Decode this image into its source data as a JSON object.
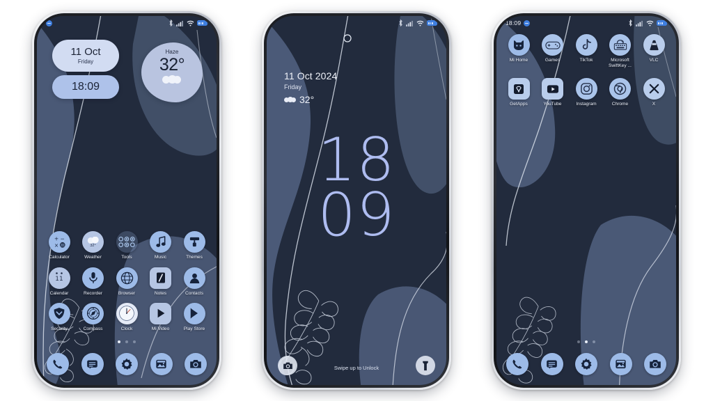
{
  "screens": {
    "home1": {
      "name": "home-screen-page-1",
      "statusbar": {
        "left_badge": "notification-dot",
        "icons": [
          "bluetooth-icon",
          "signal-icon",
          "wifi-icon",
          "battery-icon"
        ]
      },
      "widgets": {
        "date_widget": {
          "date": "11 Oct",
          "weekday": "Friday"
        },
        "time_widget": {
          "time": "18:09"
        },
        "weather_widget": {
          "condition": "Haze",
          "temperature": "32°",
          "icon": "cloud-icon"
        }
      },
      "rows": [
        [
          {
            "label": "Calculator",
            "icon": "calculator-icon"
          },
          {
            "label": "Weather",
            "icon": "weather-icon",
            "badge": "32°"
          },
          {
            "label": "Tools",
            "icon": "tools-folder-icon"
          },
          {
            "label": "Music",
            "icon": "music-note-icon"
          },
          {
            "label": "Themes",
            "icon": "themes-roller-icon"
          }
        ],
        [
          {
            "label": "Calendar",
            "icon": "calendar-icon",
            "badge": "11"
          },
          {
            "label": "Recorder",
            "icon": "microphone-icon"
          },
          {
            "label": "Browser",
            "icon": "globe-icon"
          },
          {
            "label": "Notes",
            "icon": "notes-pencil-icon"
          },
          {
            "label": "Contacts",
            "icon": "person-icon"
          }
        ],
        [
          {
            "label": "Security",
            "icon": "shield-icon"
          },
          {
            "label": "Compass",
            "icon": "compass-icon"
          },
          {
            "label": "Clock",
            "icon": "analog-clock-icon"
          },
          {
            "label": "Mi Video",
            "icon": "play-triangle-icon"
          },
          {
            "label": "Play Store",
            "icon": "play-store-icon"
          }
        ]
      ],
      "page_dots": {
        "count": 3,
        "active": 0
      },
      "dock": [
        {
          "label": "Phone",
          "icon": "phone-handset-icon"
        },
        {
          "label": "Messages",
          "icon": "message-bubble-icon"
        },
        {
          "label": "Settings",
          "icon": "gear-icon"
        },
        {
          "label": "Gallery",
          "icon": "gallery-image-icon"
        },
        {
          "label": "Camera",
          "icon": "camera-icon"
        }
      ]
    },
    "lock": {
      "name": "lock-screen",
      "statusbar": {
        "icons": [
          "bluetooth-icon",
          "signal-icon",
          "wifi-icon",
          "battery-icon"
        ]
      },
      "date": "11 Oct 2024",
      "weekday": "Friday",
      "temperature": "32°",
      "weather_icon": "cloud-icon",
      "clock_hours": "18",
      "clock_minutes": "09",
      "hint": "Swipe up to Unlock",
      "shortcut_left": "camera-icon",
      "shortcut_right": "flashlight-icon"
    },
    "home2": {
      "name": "home-screen-page-2",
      "statusbar": {
        "clock": "18:09",
        "left_badge": "notification-dot",
        "icons": [
          "bluetooth-icon",
          "signal-icon",
          "wifi-icon",
          "battery-icon"
        ]
      },
      "rows": [
        [
          {
            "label": "Mi Home",
            "icon": "mi-home-icon"
          },
          {
            "label": "Games",
            "icon": "gamepad-icon"
          },
          {
            "label": "TikTok",
            "icon": "tiktok-icon"
          },
          {
            "label": "Microsoft SwiftKey ...",
            "icon": "swiftkey-icon"
          },
          {
            "label": "VLC",
            "icon": "vlc-cone-icon"
          }
        ],
        [
          {
            "label": "GetApps",
            "icon": "getapps-bag-icon"
          },
          {
            "label": "YouTube",
            "icon": "youtube-icon"
          },
          {
            "label": "Instagram",
            "icon": "instagram-icon"
          },
          {
            "label": "Chrome",
            "icon": "chrome-icon"
          },
          {
            "label": "X",
            "icon": "x-twitter-icon"
          }
        ]
      ],
      "page_dots": {
        "count": 3,
        "active": 1
      },
      "dock": [
        {
          "label": "Phone",
          "icon": "phone-handset-icon"
        },
        {
          "label": "Messages",
          "icon": "message-bubble-icon"
        },
        {
          "label": "Settings",
          "icon": "gear-icon"
        },
        {
          "label": "Gallery",
          "icon": "gallery-image-icon"
        },
        {
          "label": "Camera",
          "icon": "camera-icon"
        }
      ]
    }
  },
  "theme": {
    "wallpaper_base": "#222b3d",
    "wallpaper_blob": "#5a6b8c",
    "accent_icon": "#9dbbe8",
    "clock_color": "#aebcf0",
    "widget_light": "#d2dcf2",
    "widget_blue": "#aec2ea",
    "page_background": "#ffffff"
  }
}
